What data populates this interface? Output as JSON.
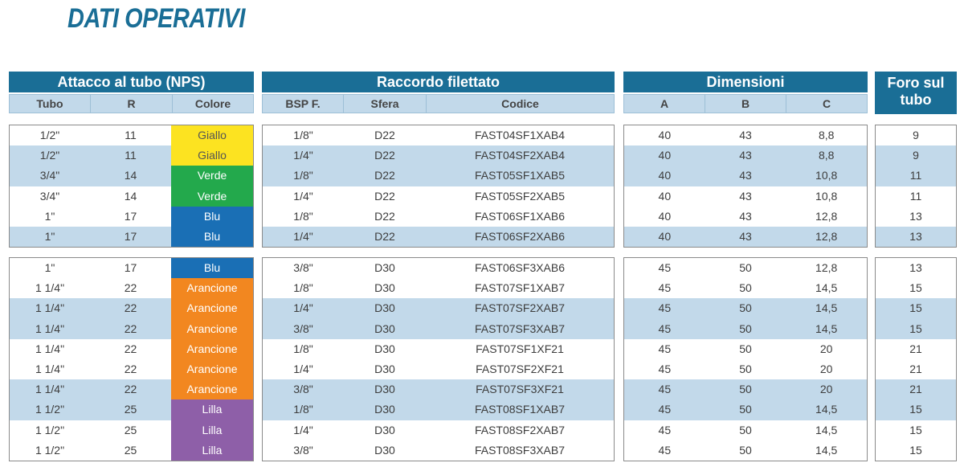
{
  "title": "DATI OPERATIVI",
  "colors": {
    "header": "#1a6e96",
    "band": "#c2d9ea",
    "Giallo": "#fce321",
    "Verde": "#23a94c",
    "Blu": "#1a6fb5",
    "Arancione": "#f28720",
    "Lilla": "#8e5fa8"
  },
  "text_colors": {
    "Giallo": "#555555",
    "Verde": "#ffffff",
    "Blu": "#ffffff",
    "Arancione": "#ffffff",
    "Lilla": "#ffffff"
  },
  "headers": {
    "attacco": "Attacco al tubo (NPS)",
    "raccordo": "Raccordo filettato",
    "dimensioni": "Dimensioni",
    "foro_line1": "Foro sul",
    "foro_line2": "tubo",
    "tubo": "Tubo",
    "r": "R",
    "colore": "Colore",
    "bsp": "BSP F.",
    "sfera": "Sfera",
    "codice": "Codice",
    "a": "A",
    "b": "B",
    "c": "C"
  },
  "groups": [
    [
      {
        "tubo": "1/2\"",
        "r": "11",
        "colore": "Giallo",
        "bsp": "1/8\"",
        "sfera": "D22",
        "codice": "FAST04SF1XAB4",
        "a": "40",
        "b": "43",
        "c": "8,8",
        "foro": "9",
        "band": "w"
      },
      {
        "tubo": "1/2\"",
        "r": "11",
        "colore": "Giallo",
        "bsp": "1/4\"",
        "sfera": "D22",
        "codice": "FAST04SF2XAB4",
        "a": "40",
        "b": "43",
        "c": "8,8",
        "foro": "9",
        "band": "b"
      },
      {
        "tubo": "3/4\"",
        "r": "14",
        "colore": "Verde",
        "bsp": "1/8\"",
        "sfera": "D22",
        "codice": "FAST05SF1XAB5",
        "a": "40",
        "b": "43",
        "c": "10,8",
        "foro": "11",
        "band": "b"
      },
      {
        "tubo": "3/4\"",
        "r": "14",
        "colore": "Verde",
        "bsp": "1/4\"",
        "sfera": "D22",
        "codice": "FAST05SF2XAB5",
        "a": "40",
        "b": "43",
        "c": "10,8",
        "foro": "11",
        "band": "w"
      },
      {
        "tubo": "1\"",
        "r": "17",
        "colore": "Blu",
        "bsp": "1/8\"",
        "sfera": "D22",
        "codice": "FAST06SF1XAB6",
        "a": "40",
        "b": "43",
        "c": "12,8",
        "foro": "13",
        "band": "w"
      },
      {
        "tubo": "1\"",
        "r": "17",
        "colore": "Blu",
        "bsp": "1/4\"",
        "sfera": "D22",
        "codice": "FAST06SF2XAB6",
        "a": "40",
        "b": "43",
        "c": "12,8",
        "foro": "13",
        "band": "b"
      }
    ],
    [
      {
        "tubo": "1\"",
        "r": "17",
        "colore": "Blu",
        "bsp": "3/8\"",
        "sfera": "D30",
        "codice": "FAST06SF3XAB6",
        "a": "45",
        "b": "50",
        "c": "12,8",
        "foro": "13",
        "band": "w"
      },
      {
        "tubo": "1 1/4\"",
        "r": "22",
        "colore": "Arancione",
        "bsp": "1/8\"",
        "sfera": "D30",
        "codice": "FAST07SF1XAB7",
        "a": "45",
        "b": "50",
        "c": "14,5",
        "foro": "15",
        "band": "w"
      },
      {
        "tubo": "1 1/4\"",
        "r": "22",
        "colore": "Arancione",
        "bsp": "1/4\"",
        "sfera": "D30",
        "codice": "FAST07SF2XAB7",
        "a": "45",
        "b": "50",
        "c": "14,5",
        "foro": "15",
        "band": "b"
      },
      {
        "tubo": "1 1/4\"",
        "r": "22",
        "colore": "Arancione",
        "bsp": "3/8\"",
        "sfera": "D30",
        "codice": "FAST07SF3XAB7",
        "a": "45",
        "b": "50",
        "c": "14,5",
        "foro": "15",
        "band": "b"
      },
      {
        "tubo": "1 1/4\"",
        "r": "22",
        "colore": "Arancione",
        "bsp": "1/8\"",
        "sfera": "D30",
        "codice": "FAST07SF1XF21",
        "a": "45",
        "b": "50",
        "c": "20",
        "foro": "21",
        "band": "w"
      },
      {
        "tubo": "1 1/4\"",
        "r": "22",
        "colore": "Arancione",
        "bsp": "1/4\"",
        "sfera": "D30",
        "codice": "FAST07SF2XF21",
        "a": "45",
        "b": "50",
        "c": "20",
        "foro": "21",
        "band": "w"
      },
      {
        "tubo": "1 1/4\"",
        "r": "22",
        "colore": "Arancione",
        "bsp": "3/8\"",
        "sfera": "D30",
        "codice": "FAST07SF3XF21",
        "a": "45",
        "b": "50",
        "c": "20",
        "foro": "21",
        "band": "b"
      },
      {
        "tubo": "1 1/2\"",
        "r": "25",
        "colore": "Lilla",
        "bsp": "1/8\"",
        "sfera": "D30",
        "codice": "FAST08SF1XAB7",
        "a": "45",
        "b": "50",
        "c": "14,5",
        "foro": "15",
        "band": "b"
      },
      {
        "tubo": "1 1/2\"",
        "r": "25",
        "colore": "Lilla",
        "bsp": "1/4\"",
        "sfera": "D30",
        "codice": "FAST08SF2XAB7",
        "a": "45",
        "b": "50",
        "c": "14,5",
        "foro": "15",
        "band": "w"
      },
      {
        "tubo": "1 1/2\"",
        "r": "25",
        "colore": "Lilla",
        "bsp": "3/8\"",
        "sfera": "D30",
        "codice": "FAST08SF3XAB7",
        "a": "45",
        "b": "50",
        "c": "14,5",
        "foro": "15",
        "band": "w"
      }
    ]
  ]
}
